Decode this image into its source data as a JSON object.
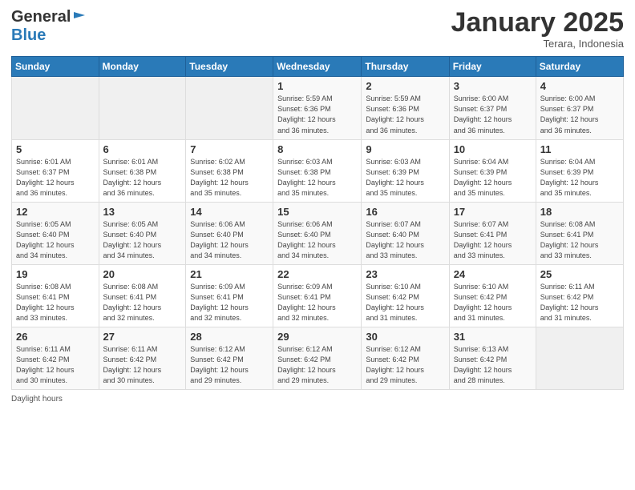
{
  "logo": {
    "general": "General",
    "blue": "Blue"
  },
  "title": "January 2025",
  "subtitle": "Terara, Indonesia",
  "days_header": [
    "Sunday",
    "Monday",
    "Tuesday",
    "Wednesday",
    "Thursday",
    "Friday",
    "Saturday"
  ],
  "weeks": [
    [
      {
        "day": "",
        "info": ""
      },
      {
        "day": "",
        "info": ""
      },
      {
        "day": "",
        "info": ""
      },
      {
        "day": "1",
        "info": "Sunrise: 5:59 AM\nSunset: 6:36 PM\nDaylight: 12 hours\nand 36 minutes."
      },
      {
        "day": "2",
        "info": "Sunrise: 5:59 AM\nSunset: 6:36 PM\nDaylight: 12 hours\nand 36 minutes."
      },
      {
        "day": "3",
        "info": "Sunrise: 6:00 AM\nSunset: 6:37 PM\nDaylight: 12 hours\nand 36 minutes."
      },
      {
        "day": "4",
        "info": "Sunrise: 6:00 AM\nSunset: 6:37 PM\nDaylight: 12 hours\nand 36 minutes."
      }
    ],
    [
      {
        "day": "5",
        "info": "Sunrise: 6:01 AM\nSunset: 6:37 PM\nDaylight: 12 hours\nand 36 minutes."
      },
      {
        "day": "6",
        "info": "Sunrise: 6:01 AM\nSunset: 6:38 PM\nDaylight: 12 hours\nand 36 minutes."
      },
      {
        "day": "7",
        "info": "Sunrise: 6:02 AM\nSunset: 6:38 PM\nDaylight: 12 hours\nand 35 minutes."
      },
      {
        "day": "8",
        "info": "Sunrise: 6:03 AM\nSunset: 6:38 PM\nDaylight: 12 hours\nand 35 minutes."
      },
      {
        "day": "9",
        "info": "Sunrise: 6:03 AM\nSunset: 6:39 PM\nDaylight: 12 hours\nand 35 minutes."
      },
      {
        "day": "10",
        "info": "Sunrise: 6:04 AM\nSunset: 6:39 PM\nDaylight: 12 hours\nand 35 minutes."
      },
      {
        "day": "11",
        "info": "Sunrise: 6:04 AM\nSunset: 6:39 PM\nDaylight: 12 hours\nand 35 minutes."
      }
    ],
    [
      {
        "day": "12",
        "info": "Sunrise: 6:05 AM\nSunset: 6:40 PM\nDaylight: 12 hours\nand 34 minutes."
      },
      {
        "day": "13",
        "info": "Sunrise: 6:05 AM\nSunset: 6:40 PM\nDaylight: 12 hours\nand 34 minutes."
      },
      {
        "day": "14",
        "info": "Sunrise: 6:06 AM\nSunset: 6:40 PM\nDaylight: 12 hours\nand 34 minutes."
      },
      {
        "day": "15",
        "info": "Sunrise: 6:06 AM\nSunset: 6:40 PM\nDaylight: 12 hours\nand 34 minutes."
      },
      {
        "day": "16",
        "info": "Sunrise: 6:07 AM\nSunset: 6:40 PM\nDaylight: 12 hours\nand 33 minutes."
      },
      {
        "day": "17",
        "info": "Sunrise: 6:07 AM\nSunset: 6:41 PM\nDaylight: 12 hours\nand 33 minutes."
      },
      {
        "day": "18",
        "info": "Sunrise: 6:08 AM\nSunset: 6:41 PM\nDaylight: 12 hours\nand 33 minutes."
      }
    ],
    [
      {
        "day": "19",
        "info": "Sunrise: 6:08 AM\nSunset: 6:41 PM\nDaylight: 12 hours\nand 33 minutes."
      },
      {
        "day": "20",
        "info": "Sunrise: 6:08 AM\nSunset: 6:41 PM\nDaylight: 12 hours\nand 32 minutes."
      },
      {
        "day": "21",
        "info": "Sunrise: 6:09 AM\nSunset: 6:41 PM\nDaylight: 12 hours\nand 32 minutes."
      },
      {
        "day": "22",
        "info": "Sunrise: 6:09 AM\nSunset: 6:41 PM\nDaylight: 12 hours\nand 32 minutes."
      },
      {
        "day": "23",
        "info": "Sunrise: 6:10 AM\nSunset: 6:42 PM\nDaylight: 12 hours\nand 31 minutes."
      },
      {
        "day": "24",
        "info": "Sunrise: 6:10 AM\nSunset: 6:42 PM\nDaylight: 12 hours\nand 31 minutes."
      },
      {
        "day": "25",
        "info": "Sunrise: 6:11 AM\nSunset: 6:42 PM\nDaylight: 12 hours\nand 31 minutes."
      }
    ],
    [
      {
        "day": "26",
        "info": "Sunrise: 6:11 AM\nSunset: 6:42 PM\nDaylight: 12 hours\nand 30 minutes."
      },
      {
        "day": "27",
        "info": "Sunrise: 6:11 AM\nSunset: 6:42 PM\nDaylight: 12 hours\nand 30 minutes."
      },
      {
        "day": "28",
        "info": "Sunrise: 6:12 AM\nSunset: 6:42 PM\nDaylight: 12 hours\nand 29 minutes."
      },
      {
        "day": "29",
        "info": "Sunrise: 6:12 AM\nSunset: 6:42 PM\nDaylight: 12 hours\nand 29 minutes."
      },
      {
        "day": "30",
        "info": "Sunrise: 6:12 AM\nSunset: 6:42 PM\nDaylight: 12 hours\nand 29 minutes."
      },
      {
        "day": "31",
        "info": "Sunrise: 6:13 AM\nSunset: 6:42 PM\nDaylight: 12 hours\nand 28 minutes."
      },
      {
        "day": "",
        "info": ""
      }
    ]
  ],
  "footer": {
    "daylight_label": "Daylight hours"
  }
}
